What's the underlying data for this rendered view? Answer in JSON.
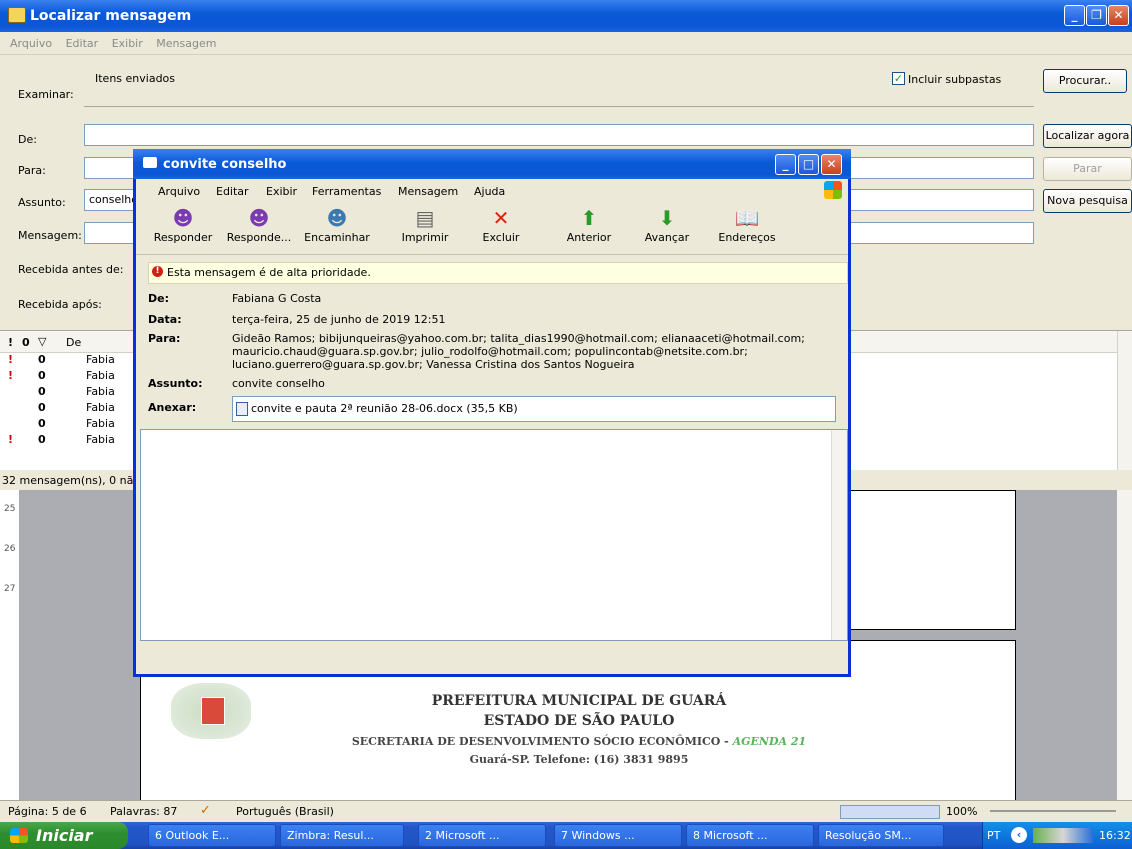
{
  "main_window": {
    "title": "Localizar mensagem",
    "menu": [
      "Arquivo",
      "Editar",
      "Exibir",
      "Mensagem"
    ],
    "labels": {
      "examinar": "Examinar:",
      "de": "De:",
      "para": "Para:",
      "assunto": "Assunto:",
      "mensagem": "Mensagem:",
      "recebida_antes": "Recebida antes de:",
      "recebida_apos": "Recebida após:"
    },
    "examinar_value": "Itens enviados",
    "incluir_subpastas": "Incluir subpastas",
    "assunto_value": "conselho",
    "buttons": {
      "procurar": "Procurar..",
      "localizar_agora": "Localizar agora",
      "parar": "Parar",
      "nova_pesquisa": "Nova pesquisa"
    },
    "list_header_from": "De",
    "rows": [
      {
        "priority": "!",
        "attach": "0",
        "from": "Fabia"
      },
      {
        "priority": "!",
        "attach": "0",
        "from": "Fabia"
      },
      {
        "priority": "",
        "attach": "0",
        "from": "Fabia"
      },
      {
        "priority": "",
        "attach": "0",
        "from": "Fabia"
      },
      {
        "priority": "",
        "attach": "0",
        "from": "Fabia"
      },
      {
        "priority": "!",
        "attach": "0",
        "from": "Fabia"
      }
    ],
    "status": "32 mensagem(ns), 0 nã"
  },
  "message": {
    "title": "convite conselho",
    "menu": [
      "Arquivo",
      "Editar",
      "Exibir",
      "Ferramentas",
      "Mensagem",
      "Ajuda"
    ],
    "toolbar": [
      "Responder",
      "Responde...",
      "Encaminhar",
      "Imprimir",
      "Excluir",
      "Anterior",
      "Avançar",
      "Endereços"
    ],
    "priority_notice": "Esta mensagem é de alta prioridade.",
    "labels": {
      "de": "De:",
      "data": "Data:",
      "para": "Para:",
      "assunto": "Assunto:",
      "anexar": "Anexar:"
    },
    "from": "Fabiana G Costa",
    "date": "terça-feira, 25 de junho de 2019 12:51",
    "to_line1": "Gideão Ramos; bibijunqueiras@yahoo.com.br; talita_dias1990@hotmail.com; elianaaceti@hotmail.com;",
    "to_line2": "mauricio.chaud@guara.sp.gov.br; julio_rodolfo@hotmail.com; populincontab@netsite.com.br;",
    "to_line3": "luciano.guerrero@guara.sp.gov.br; Vanessa Cristina dos Santos Nogueira",
    "subject": "convite conselho",
    "attachment": "convite e pauta 2ª reunião 28-06.docx (35,5 KB)"
  },
  "document": {
    "line1": "PREFEITURA MUNICIPAL DE GUARÁ",
    "line2": "ESTADO DE SÃO PAULO",
    "line3a": "SECRETARIA DE DESENVOLVIMENTO SÓCIO ECONÔMICO - ",
    "line3b": "AGENDA 21",
    "line4": "Guará-SP.  Telefone: (16) 3831 9895",
    "ruler": [
      "25",
      "26",
      "27"
    ]
  },
  "word_status": {
    "pagina": "Página: 5 de 6",
    "palavras": "Palavras: 87",
    "idioma": "Português (Brasil)",
    "zoom": "100%"
  },
  "taskbar": {
    "start": "Iniciar",
    "tasks": [
      "6 Outlook E...",
      "Zimbra: Resul...",
      "2 Microsoft ...",
      "7 Windows ...",
      "8 Microsoft ...",
      "Resolução SM..."
    ],
    "lang": "PT",
    "time": "16:32"
  }
}
